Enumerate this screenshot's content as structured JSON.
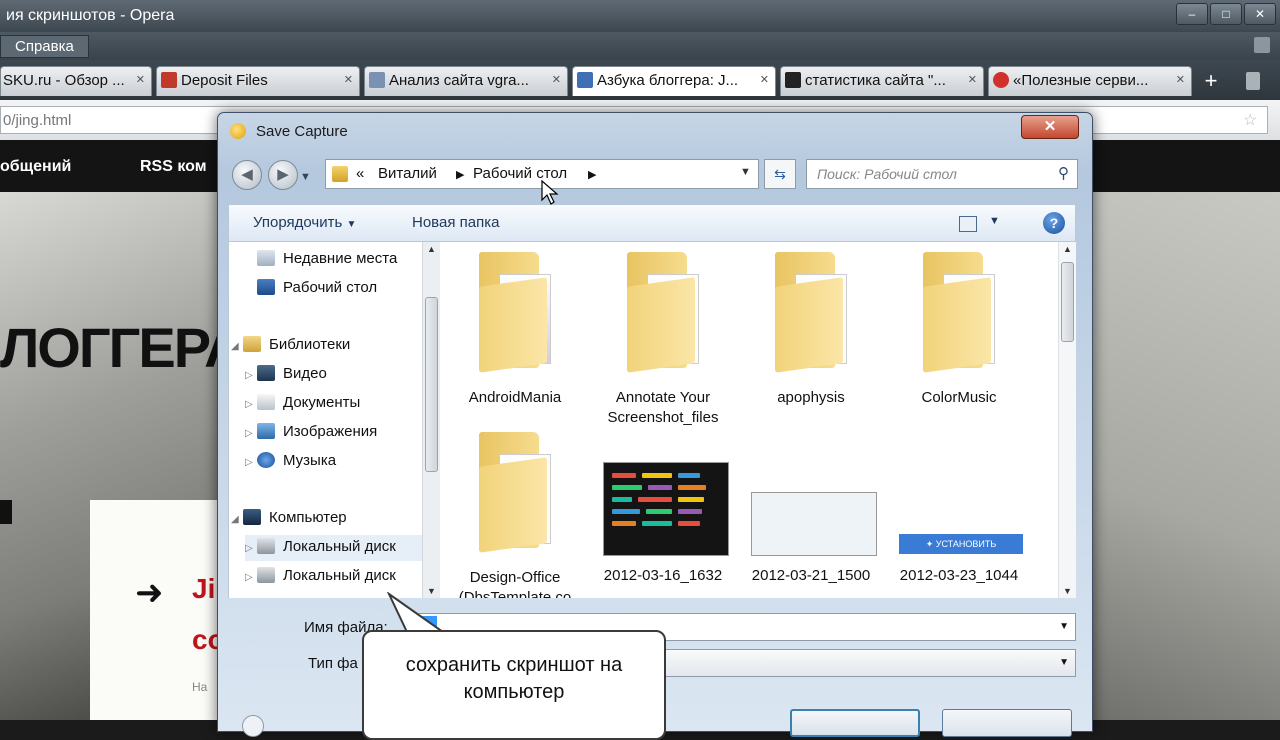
{
  "browser": {
    "title": "ия скриншотов - Opera",
    "menu": "Справка",
    "tabs": [
      {
        "label": "SKU.ru - Обзор ..."
      },
      {
        "label": "Deposit Files"
      },
      {
        "label": "Анализ сайта vgra..."
      },
      {
        "label": "Азбука блоггера: J..."
      },
      {
        "label": "статистика сайта \"..."
      },
      {
        "label": "«Полезные серви..."
      }
    ],
    "address": "0/jing.html"
  },
  "page": {
    "nav": [
      "общений",
      "RSS ком"
    ],
    "logo": "ЛОГГЕРА",
    "heading1": "Ji",
    "heading2": "co",
    "small": "На"
  },
  "dialog": {
    "title": "Save Capture",
    "breadcrumb": [
      "«",
      "Виталий",
      "Рабочий стол"
    ],
    "search_placeholder": "Поиск: Рабочий стол",
    "organize": "Упорядочить",
    "new_folder": "Новая папка",
    "nav_items": [
      {
        "label": "Недавние места",
        "icon": "recent-places-icon"
      },
      {
        "label": "Рабочий стол",
        "icon": "desktop-icon"
      },
      {
        "label": "Библиотеки",
        "icon": "libraries-icon"
      },
      {
        "label": "Видео",
        "icon": "video-icon"
      },
      {
        "label": "Документы",
        "icon": "documents-icon"
      },
      {
        "label": "Изображения",
        "icon": "pictures-icon"
      },
      {
        "label": "Музыка",
        "icon": "music-icon"
      },
      {
        "label": "Компьютер",
        "icon": "computer-icon"
      },
      {
        "label": "Локальный диск",
        "icon": "local-disk-icon"
      },
      {
        "label": "Локальный диск",
        "icon": "local-disk-icon"
      }
    ],
    "files": [
      {
        "name": "AndroidMania",
        "kind": "folder"
      },
      {
        "name": "Annotate Your Screenshot_files",
        "kind": "folder"
      },
      {
        "name": "apophysis",
        "kind": "folder"
      },
      {
        "name": "ColorMusic",
        "kind": "folder"
      },
      {
        "name": "Design-Office (DbsTemplate.co",
        "kind": "folder"
      },
      {
        "name": "2012-03-16_1632",
        "kind": "image"
      },
      {
        "name": "2012-03-21_1500",
        "kind": "image"
      },
      {
        "name": "2012-03-23_1044",
        "kind": "image"
      }
    ],
    "thumb_button": "✦ УСТАНОВИТЬ",
    "filename_label": "Имя файла:",
    "filetype_label": "Тип фа"
  },
  "callout": {
    "text": "сохранить скриншот на компьютер"
  }
}
